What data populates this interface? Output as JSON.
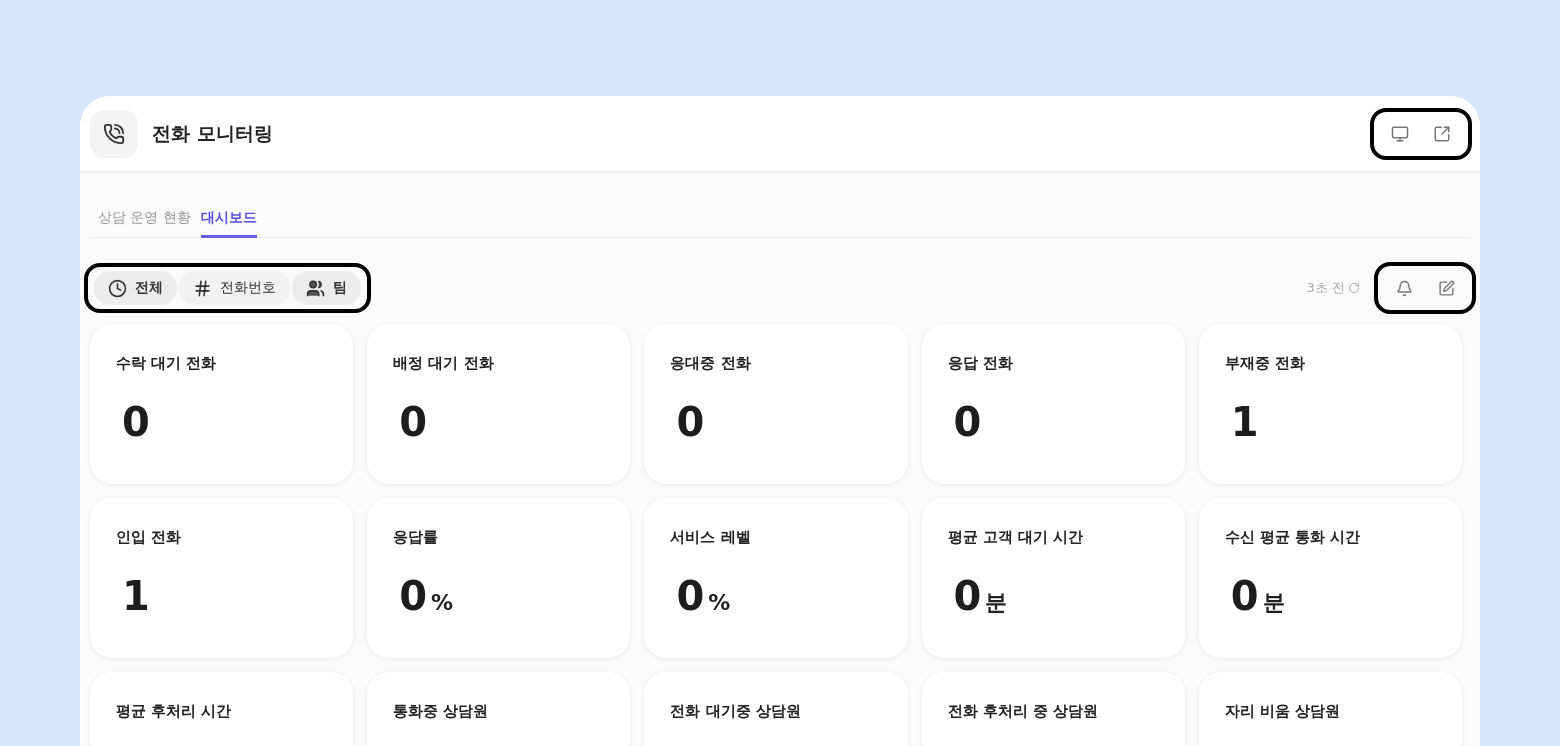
{
  "header": {
    "title": "전화 모니터링"
  },
  "tabs": [
    {
      "label": "상담 운영 현황",
      "selected": false
    },
    {
      "label": "대시보드",
      "selected": true
    }
  ],
  "filters": [
    {
      "kind": "clock",
      "label": "전체",
      "selected": true
    },
    {
      "kind": "hash",
      "label": "전화번호",
      "selected": false
    },
    {
      "kind": "people",
      "label": "팀",
      "selected": true
    }
  ],
  "refresh": {
    "label": "3초 전"
  },
  "cards": [
    {
      "title": "수락 대기 전화",
      "value": "0"
    },
    {
      "title": "배정 대기 전화",
      "value": "0"
    },
    {
      "title": "응대중 전화",
      "value": "0"
    },
    {
      "title": "응답 전화",
      "value": "0"
    },
    {
      "title": "부재중 전화",
      "value": "1"
    },
    {
      "title": "인입 전화",
      "value": "1"
    },
    {
      "title": "응답률",
      "value": "0",
      "unit": "%"
    },
    {
      "title": "서비스 레벨",
      "value": "0",
      "unit": "%"
    },
    {
      "title": "평균 고객 대기 시간",
      "value": "0",
      "unit": "분"
    },
    {
      "title": "수신 평균 통화 시간",
      "value": "0",
      "unit": "분"
    },
    {
      "title": "평균 후처리 시간"
    },
    {
      "title": "통화중 상담원"
    },
    {
      "title": "전화 대기중 상담원"
    },
    {
      "title": "전화 후처리 중 상담원"
    },
    {
      "title": "자리 비움 상담원"
    }
  ]
}
